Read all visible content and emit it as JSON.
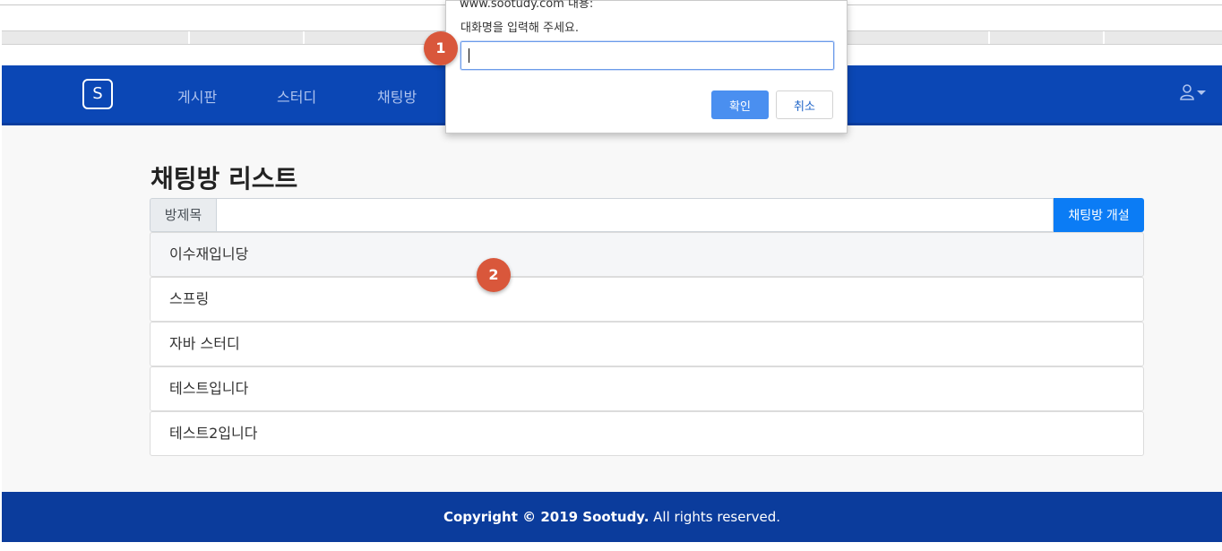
{
  "dialog": {
    "origin": "www.sootudy.com 내용:",
    "message": "대화명을 입력해 주세요.",
    "input_value": "",
    "ok_label": "확인",
    "cancel_label": "취소"
  },
  "navbar": {
    "brand": "S",
    "links": [
      "게시판",
      "스터디",
      "채팅방"
    ],
    "user_icon": "user-icon"
  },
  "main": {
    "title": "채팅방 리스트",
    "search_addon": "방제목",
    "search_value": "",
    "create_button": "채팅방 개설",
    "rooms": [
      "이수재입니당",
      "스프링",
      "자바 스터디",
      "테스트입니다",
      "테스트2입니다"
    ]
  },
  "footer": {
    "copyright_bold": "Copyright © 2019 Sootudy.",
    "copyright_rest": " All rights reserved."
  },
  "annotations": [
    "1",
    "2"
  ],
  "colors": {
    "navbar": "#0b47b5",
    "footer": "#0b3c9c",
    "primary_button": "#0b7cf5",
    "badge": "#d9573b"
  }
}
